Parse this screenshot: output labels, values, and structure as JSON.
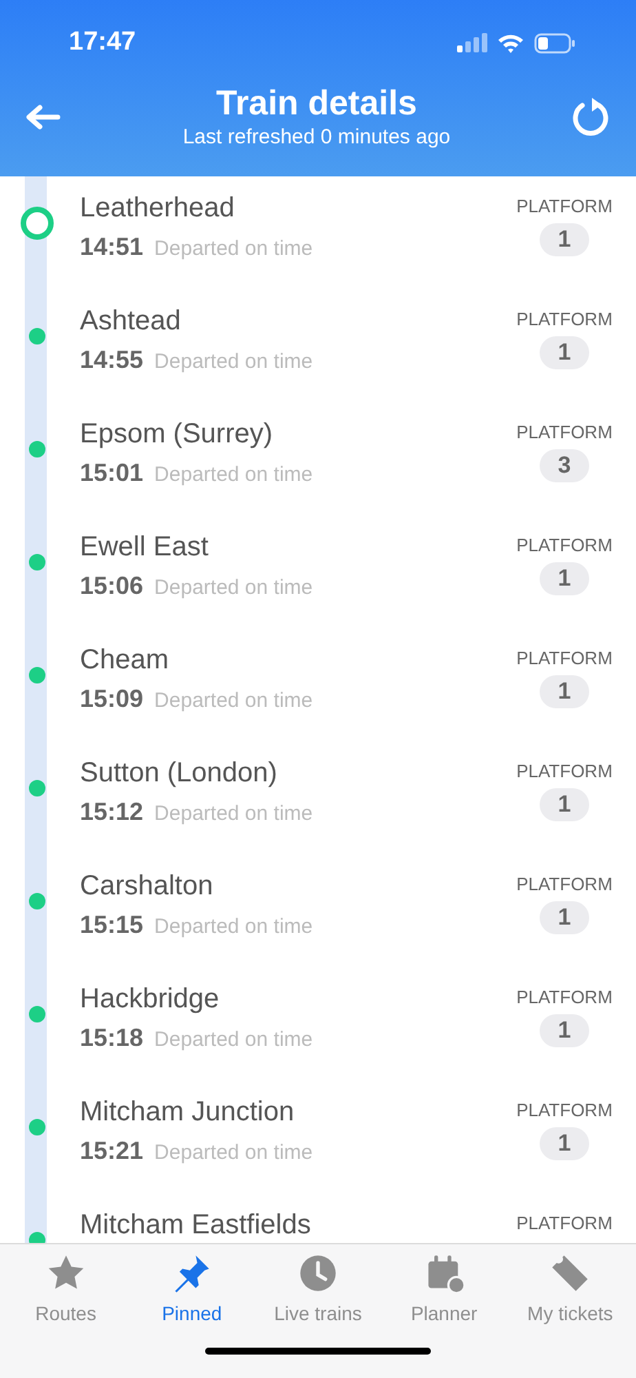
{
  "status_bar": {
    "time": "17:47"
  },
  "header": {
    "title": "Train details",
    "subtitle": "Last refreshed 0 minutes ago"
  },
  "stops": [
    {
      "kind": "origin",
      "name": "Leatherhead",
      "time": "14:51",
      "status": "Departed on time",
      "platform_label": "PLATFORM",
      "platform": "1"
    },
    {
      "kind": "stop",
      "name": "Ashtead",
      "time": "14:55",
      "status": "Departed on time",
      "platform_label": "PLATFORM",
      "platform": "1"
    },
    {
      "kind": "stop",
      "name": "Epsom (Surrey)",
      "time": "15:01",
      "status": "Departed on time",
      "platform_label": "PLATFORM",
      "platform": "3"
    },
    {
      "kind": "stop",
      "name": "Ewell East",
      "time": "15:06",
      "status": "Departed on time",
      "platform_label": "PLATFORM",
      "platform": "1"
    },
    {
      "kind": "stop",
      "name": "Cheam",
      "time": "15:09",
      "status": "Departed on time",
      "platform_label": "PLATFORM",
      "platform": "1"
    },
    {
      "kind": "stop",
      "name": "Sutton (London)",
      "time": "15:12",
      "status": "Departed on time",
      "platform_label": "PLATFORM",
      "platform": "1"
    },
    {
      "kind": "stop",
      "name": "Carshalton",
      "time": "15:15",
      "status": "Departed on time",
      "platform_label": "PLATFORM",
      "platform": "1"
    },
    {
      "kind": "stop",
      "name": "Hackbridge",
      "time": "15:18",
      "status": "Departed on time",
      "platform_label": "PLATFORM",
      "platform": "1"
    },
    {
      "kind": "stop",
      "name": "Mitcham Junction",
      "time": "15:21",
      "status": "Departed on time",
      "platform_label": "PLATFORM",
      "platform": "1"
    },
    {
      "kind": "stop",
      "name": "Mitcham Eastfields",
      "platform_label": "PLATFORM"
    }
  ],
  "tabs": [
    {
      "kind": "star",
      "label": "Routes",
      "selected": false
    },
    {
      "kind": "pin",
      "label": "Pinned",
      "selected": true
    },
    {
      "kind": "clock",
      "label": "Live trains",
      "selected": false
    },
    {
      "kind": "calendar",
      "label": "Planner",
      "selected": false
    },
    {
      "kind": "ticket",
      "label": "My tickets",
      "selected": false
    }
  ]
}
